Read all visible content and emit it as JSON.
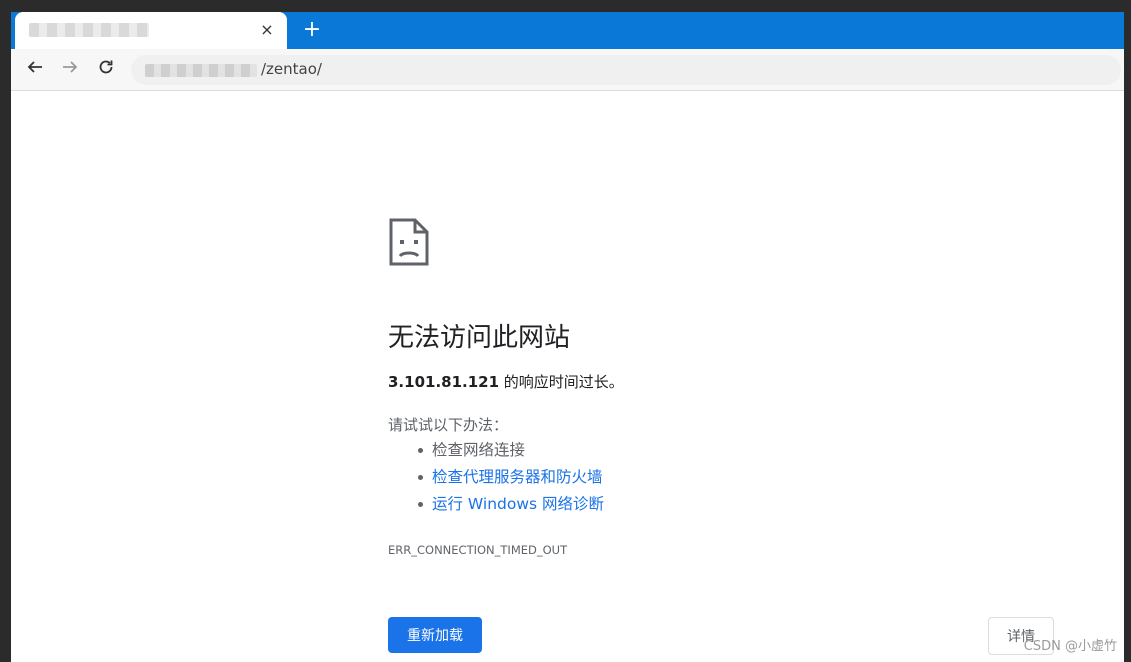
{
  "tab": {
    "close_glyph": "×",
    "new_tab_glyph": "+"
  },
  "toolbar": {
    "back_icon": "arrow-left-icon",
    "forward_icon": "arrow-right-icon",
    "reload_icon": "reload-icon",
    "url_visible": "/zentao/"
  },
  "page": {
    "headline": "无法访问此网站",
    "host": "3.101.81.121",
    "host_suffix": " 的响应时间过长。",
    "suggestion_intro": "请试试以下办法：",
    "suggestions": [
      {
        "text": "检查网络连接",
        "link": false
      },
      {
        "text": "检查代理服务器和防火墙",
        "link": true
      },
      {
        "text": "运行 Windows 网络诊断",
        "link": true
      }
    ],
    "error_code": "ERR_CONNECTION_TIMED_OUT",
    "reload_button": "重新加载",
    "details_button": "详情"
  },
  "watermark": "CSDN @小虚竹",
  "colors": {
    "tabbar": "#0a78d7",
    "primary": "#1a73e8",
    "link": "#1a73e8"
  }
}
